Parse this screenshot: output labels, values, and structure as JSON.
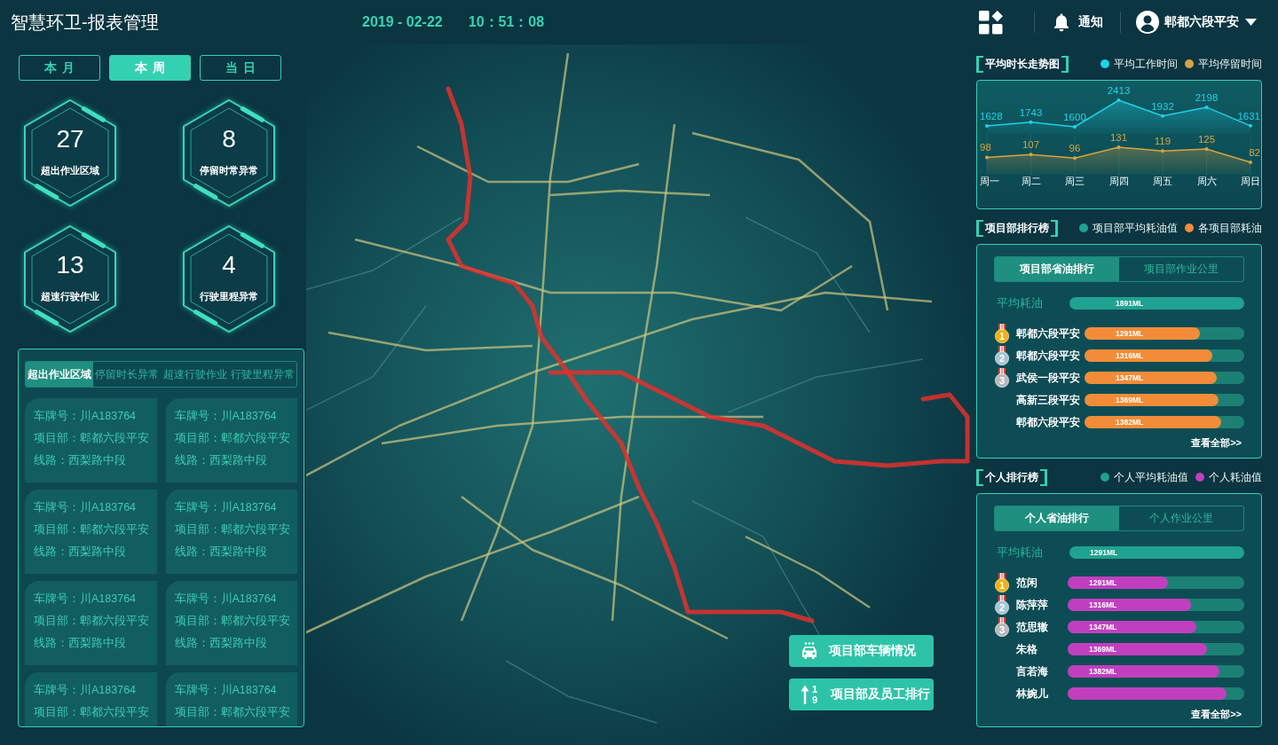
{
  "header": {
    "title": "智慧环卫-报表管理",
    "date": "2019 - 02-22",
    "time": "10：51：08",
    "notification": "通知",
    "user": "郫都六段平安"
  },
  "period_tabs": [
    {
      "label": "本月",
      "selected": false
    },
    {
      "label": "本周",
      "selected": true
    },
    {
      "label": "当日",
      "selected": false
    }
  ],
  "stats": [
    {
      "value": "27",
      "label": "超出作业区域"
    },
    {
      "value": "8",
      "label": "停留时常异常"
    },
    {
      "value": "13",
      "label": "超速行驶作业"
    },
    {
      "value": "4",
      "label": "行驶里程异常"
    }
  ],
  "alerts": {
    "tabs": [
      {
        "label": "超出作业区域",
        "selected": true
      },
      {
        "label": "停留时长异常",
        "selected": false
      },
      {
        "label": "超速行驶作业",
        "selected": false
      },
      {
        "label": "行驶里程异常",
        "selected": false
      }
    ],
    "cards": [
      {
        "lines": [
          "车牌号：川A183764",
          "项目部：郫都六段平安",
          "线路：西梨路中段"
        ]
      },
      {
        "lines": [
          "车牌号：川A183764",
          "项目部：郫都六段平安",
          "线路：西梨路中段"
        ]
      },
      {
        "lines": [
          "车牌号：川A183764",
          "项目部：郫都六段平安",
          "线路：西梨路中段"
        ]
      },
      {
        "lines": [
          "车牌号：川A183764",
          "项目部：郫都六段平安",
          "线路：西梨路中段"
        ]
      },
      {
        "lines": [
          "车牌号：川A183764",
          "项目部：郫都六段平安",
          "线路：西梨路中段"
        ]
      },
      {
        "lines": [
          "车牌号：川A183764",
          "项目部：郫都六段平安",
          "线路：西梨路中段"
        ]
      },
      {
        "lines": [
          "车牌号：川A183764",
          "项目部：郫都六段平安"
        ]
      },
      {
        "lines": [
          "车牌号：川A183764",
          "项目部：郫都六段平安"
        ]
      }
    ]
  },
  "map_buttons": [
    {
      "kind": "vehicles",
      "label": "项目部车辆情况"
    },
    {
      "kind": "ranking",
      "label": "项目部及员工排行",
      "icon_digits": [
        "1",
        "9"
      ]
    }
  ],
  "duration_trend": {
    "title": "平均时长走势图",
    "legend": [
      {
        "label": "平均工作时间",
        "color": "#1ed3eb"
      },
      {
        "label": "平均停留时间",
        "color": "#d9a440"
      }
    ],
    "charts": [
      {
        "chart_data": {
          "type": "area",
          "series": [
            {
              "color": "#1ed3eb",
              "values": [
                1628,
                1743,
                1600,
                2413,
                1932,
                2198,
                1631
              ]
            }
          ],
          "data_labels": true
        }
      },
      {
        "chart_data": {
          "type": "area",
          "categories": [
            "周一",
            "周二",
            "周三",
            "周四",
            "周五",
            "周六",
            "周日"
          ],
          "series": [
            {
              "color": "#d9a440",
              "values": [
                98,
                107,
                96,
                131,
                119,
                125,
                82
              ]
            }
          ],
          "data_labels": true,
          "grid": true
        }
      }
    ]
  },
  "project_ranking": {
    "title": "项目部排行榜",
    "legend": [
      {
        "label": "项目部平均耗油值",
        "color": "#1fa28f"
      },
      {
        "label": "各项目部耗油",
        "color": "#f28c38"
      }
    ],
    "tabs": [
      {
        "label": "项目部省油排行",
        "selected": true
      },
      {
        "label": "项目部作业公里",
        "selected": false
      }
    ],
    "average": {
      "label": "平均耗油",
      "reading": "1891ML"
    },
    "rows": [
      {
        "medal": "1",
        "color": "#f2b10c",
        "name": "郫都六段平安",
        "reading": "1291ML",
        "level": 0.72
      },
      {
        "medal": "2",
        "color": "#a7c6d6",
        "name": "郫都六段平安",
        "reading": "1316ML",
        "level": 0.8
      },
      {
        "medal": "3",
        "color": "#b8babd",
        "name": "武侯一段平安",
        "reading": "1347ML",
        "level": 0.83
      },
      {
        "name": "高新三段平安",
        "reading": "1369ML",
        "level": 0.84
      },
      {
        "name": "郫都六段平安",
        "reading": "1382ML",
        "level": 0.855
      }
    ],
    "more_link": "查看全部>>"
  },
  "personal_ranking": {
    "title": "个人排行榜",
    "legend": [
      {
        "label": "个人平均耗油值",
        "color": "#1fa28f"
      },
      {
        "label": "个人耗油值",
        "color": "#c13fbf"
      }
    ],
    "tabs": [
      {
        "label": "个人省油排行",
        "selected": true
      },
      {
        "label": "个人作业公里",
        "selected": false
      }
    ],
    "average": {
      "label": "平均耗油",
      "reading": "1291ML"
    },
    "rows": [
      {
        "medal": "1",
        "color": "#f2b10c",
        "name": "范闲",
        "reading": "1291ML",
        "level": 0.57
      },
      {
        "medal": "2",
        "color": "#a7c6d6",
        "name": "陈萍萍",
        "reading": "1316ML",
        "level": 0.7
      },
      {
        "medal": "3",
        "color": "#b8babd",
        "name": "范思辙",
        "reading": "1347ML",
        "level": 0.73
      },
      {
        "name": "朱格",
        "reading": "1369ML",
        "level": 0.79
      },
      {
        "name": "言若海",
        "reading": "1382ML",
        "level": 0.86
      },
      {
        "name": "林婉儿",
        "level": 0.9
      }
    ],
    "more_link": "查看全部>>"
  }
}
